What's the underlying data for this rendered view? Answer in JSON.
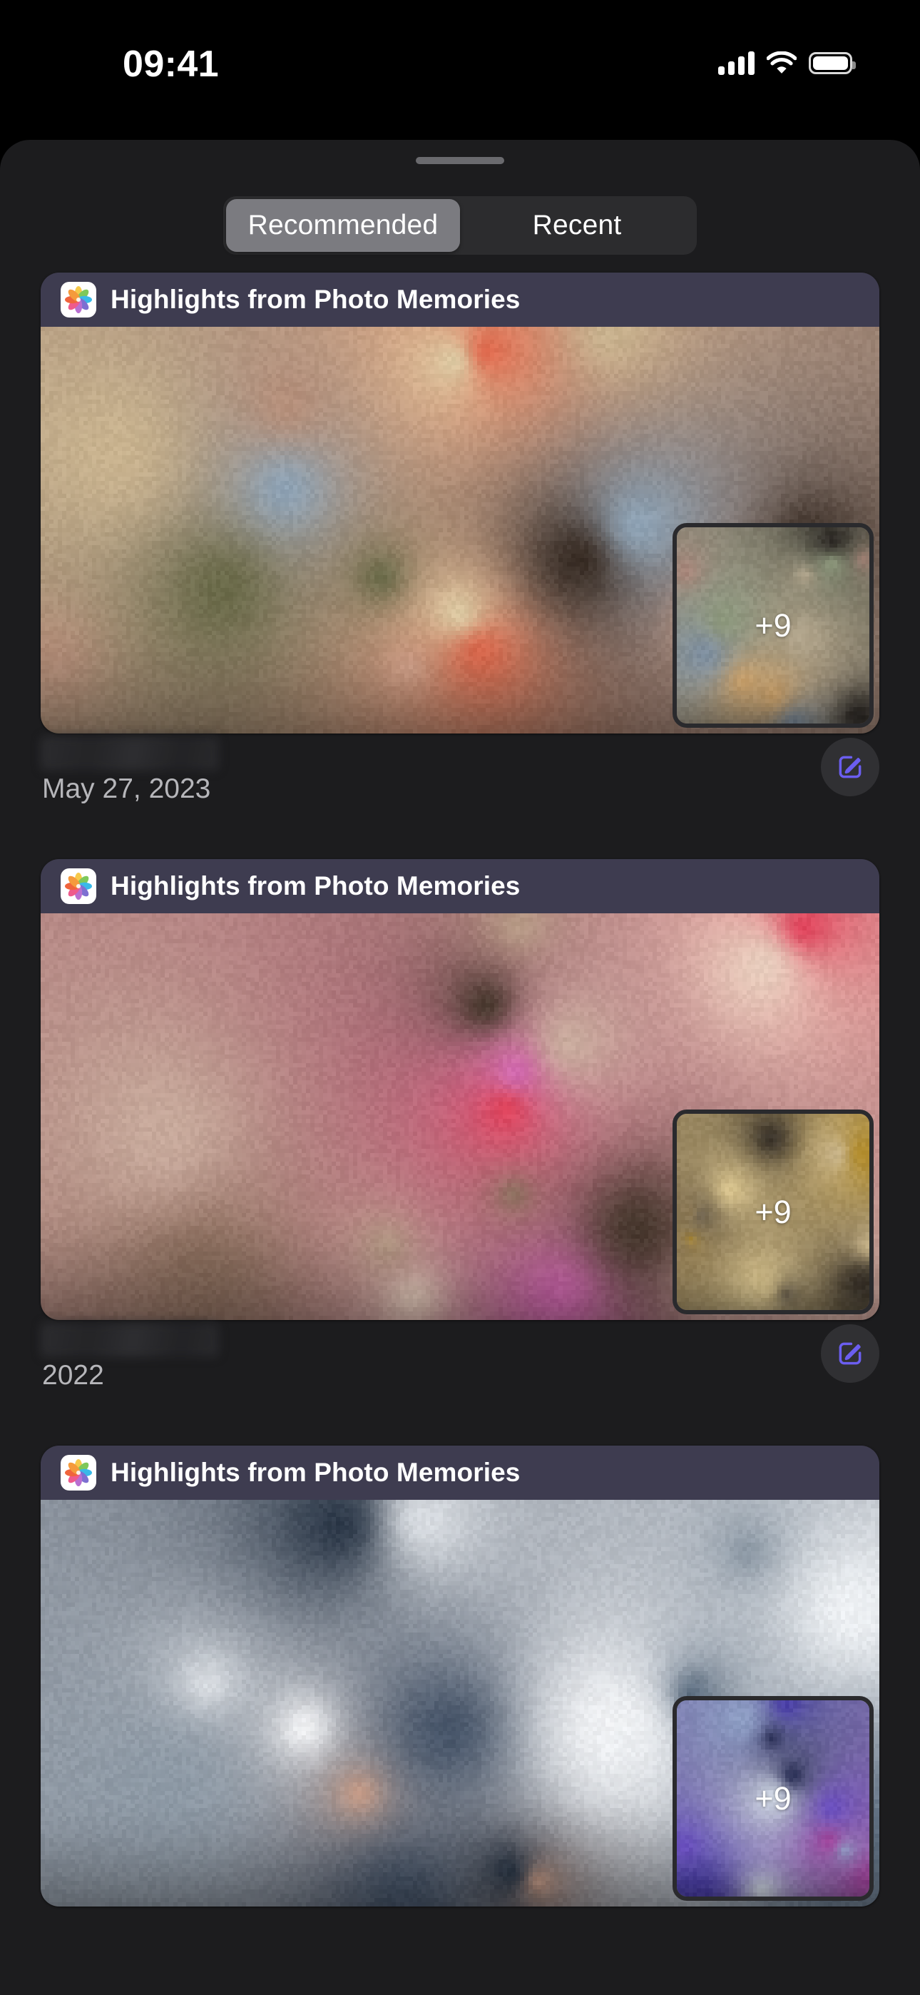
{
  "status_bar": {
    "time": "09:41",
    "cellular_icon": "cellular-signal-icon",
    "cellular_bars": 4,
    "wifi_icon": "wifi-icon",
    "battery_icon": "battery-icon",
    "battery_level_percent": 100
  },
  "sheet": {
    "grabber": "sheet-grabber-handle"
  },
  "segmented_control": {
    "selected": "Recommended",
    "options": [
      {
        "label": "Recommended",
        "selected": true
      },
      {
        "label": "Recent",
        "selected": false
      }
    ]
  },
  "colors": {
    "screen_background": "#000000",
    "sheet_background": "#1c1c1e",
    "segment_track": "#2c2c2e",
    "segment_selected": "#7b7b80",
    "card_background": "#2a2a2d",
    "card_header_background": "#3e3c50",
    "accent_edit": "#6b5ef0",
    "date_text": "#b6b6ba",
    "title_text": "#ffffff"
  },
  "cards": [
    {
      "app_icon": "photos-app-icon",
      "title": "Highlights from Photo Memories",
      "overflow_badge": "+9",
      "date": "May 27, 2023",
      "edit_button_icon": "compose-edit-icon",
      "palette": [
        "#c9b38f",
        "#d7a68e",
        "#b58f7a",
        "#6b6b4a",
        "#e06a4e",
        "#8fa3b5",
        "#3a2e26",
        "#dcc9a2"
      ],
      "thumb_palette": [
        "#8f9a7e",
        "#a8867a",
        "#7e8fa0",
        "#c9a06a",
        "#2e2a26",
        "#b5a88f"
      ]
    },
    {
      "app_icon": "photos-app-icon",
      "title": "Highlights from Photo Memories",
      "overflow_badge": "+9",
      "date": "2022",
      "edit_button_icon": "compose-edit-icon",
      "palette": [
        "#b79a86",
        "#d6b5a6",
        "#8e7160",
        "#d26ab0",
        "#e0445c",
        "#c8aa9c",
        "#4a3a30",
        "#e8cdbd"
      ],
      "thumb_palette": [
        "#b08a2a",
        "#8e7a55",
        "#d9c48e",
        "#6e6350",
        "#c8b48a",
        "#3a332a"
      ]
    },
    {
      "app_icon": "photos-app-icon",
      "title": "Highlights from Photo Memories",
      "overflow_badge": "+9",
      "date": "",
      "edit_button_icon": "compose-edit-icon",
      "palette": [
        "#d9dde2",
        "#f2f3f5",
        "#8e9aa6",
        "#5a6b7e",
        "#c49a86",
        "#48566a",
        "#eef1f4",
        "#2e3a4a"
      ],
      "thumb_palette": [
        "#8e9ec4",
        "#4a3ea8",
        "#a0459c",
        "#d0d8e4",
        "#6a4fbf",
        "#2a2f55"
      ]
    }
  ]
}
